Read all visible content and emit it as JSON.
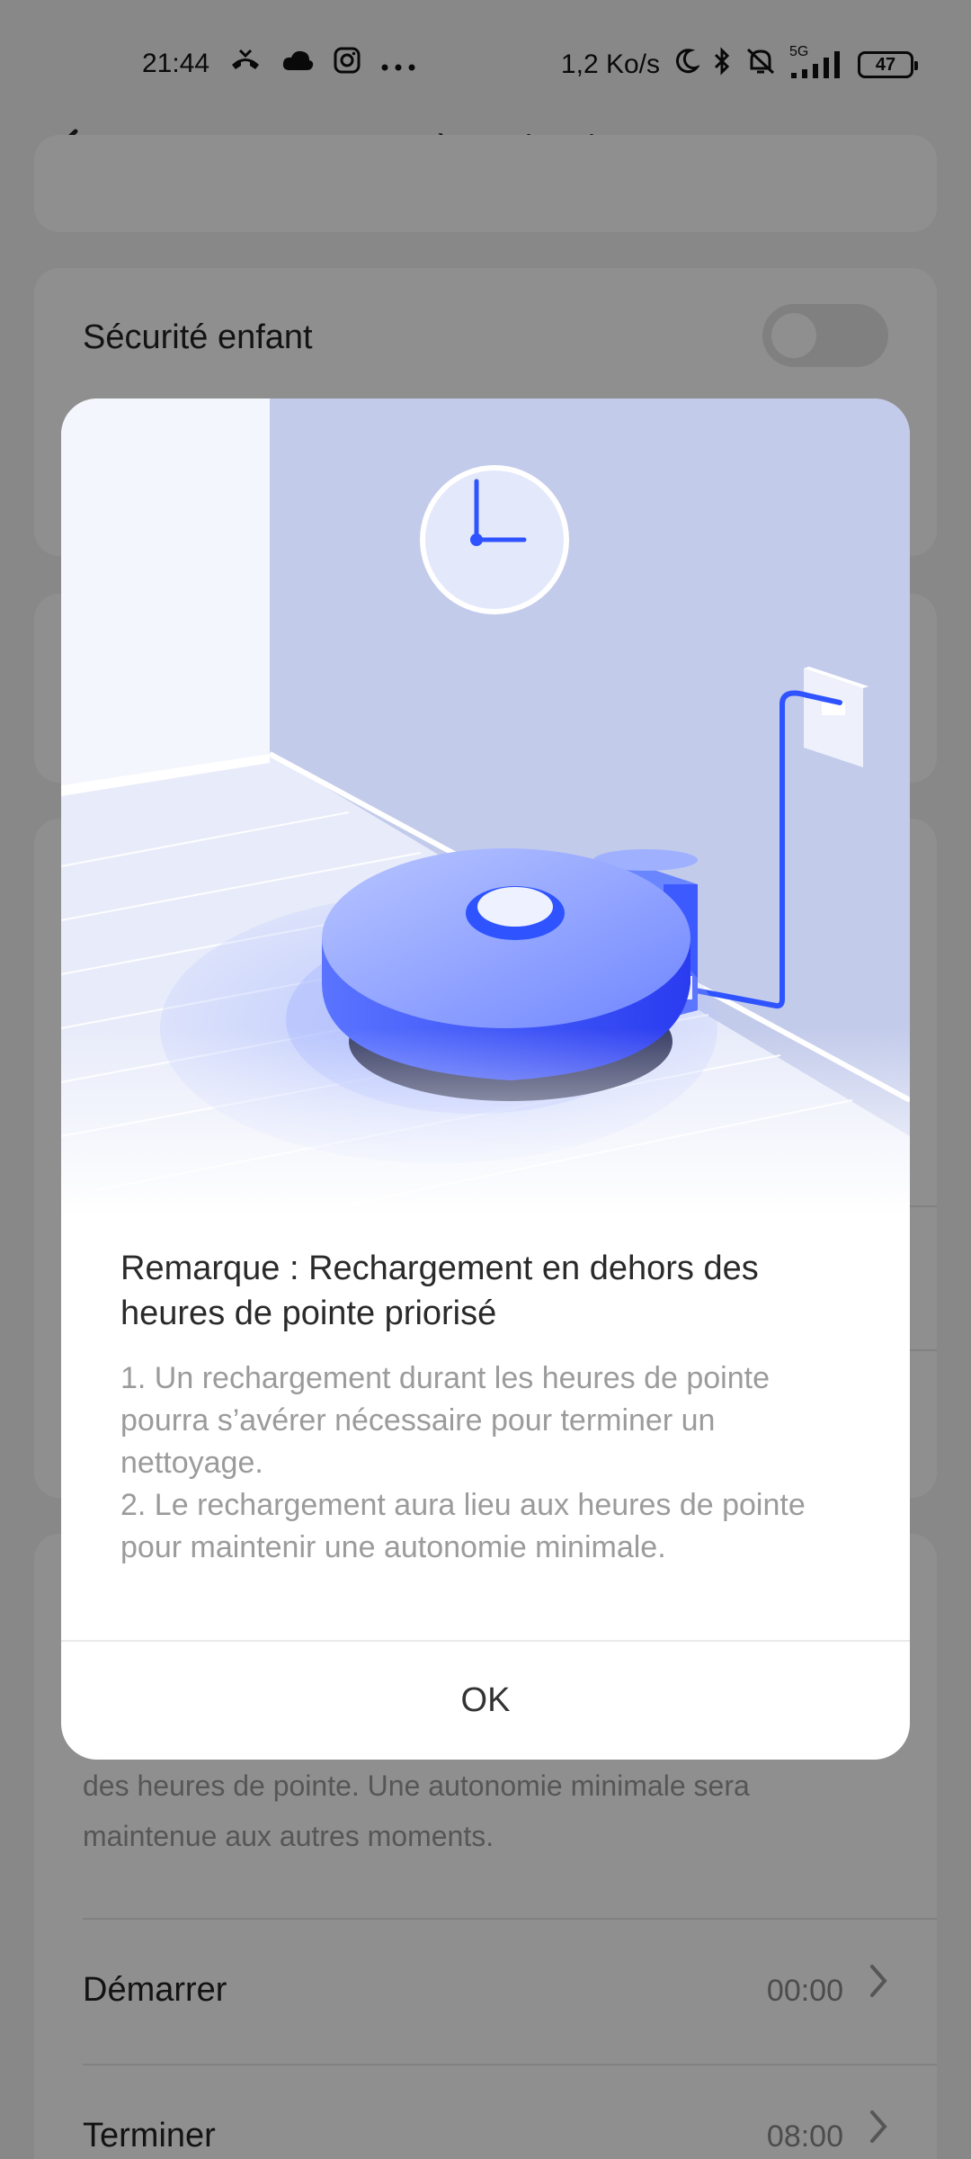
{
  "status_bar": {
    "time": "21:44",
    "icons_left": [
      "missed-call-icon",
      "cloud-icon",
      "instagram-icon",
      "more-dots-icon"
    ],
    "network_speed": "1,2 Ko/s",
    "icons_right": [
      "moon-icon",
      "bluetooth-icon",
      "muted-bell-icon",
      "signal-5g-icon"
    ],
    "network_type": "5G",
    "battery_level": "47"
  },
  "header": {
    "back_icon": "back-arrow-icon",
    "title": "Paramètres du robot"
  },
  "settings": {
    "child_safety_label": "Sécurité enfant",
    "child_safety_on": false,
    "offpeak_description": "des heures de pointe. Une autonomie minimale sera maintenue aux autres moments.",
    "start_label": "Démarrer",
    "start_value": "00:00",
    "end_label": "Terminer",
    "end_value": "08:00"
  },
  "dialog": {
    "illustration_icons": [
      "wall-clock-icon",
      "robot-vacuum-icon",
      "charging-dock-icon",
      "power-outlet-icon"
    ],
    "title": "Remarque : Rechargement en dehors des heures de pointe priorisé",
    "body_lines": [
      "1. Un rechargement durant les heures de pointe pourra s’avérer nécessaire pour terminer un nettoyage.",
      "2. Le rechargement aura lieu aux heures de pointe pour maintenir une autonomie minimale."
    ],
    "ok_label": "OK"
  },
  "colors": {
    "accent_blue": "#3d5afe",
    "wall": "#c5cdee",
    "overlay": "rgba(0,0,0,0.44)"
  }
}
